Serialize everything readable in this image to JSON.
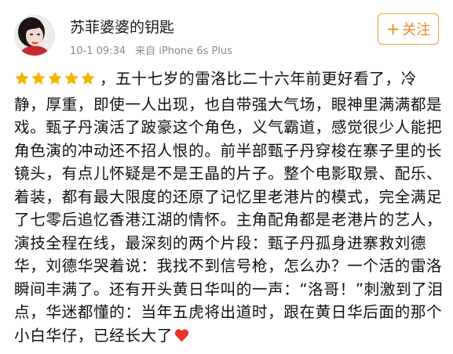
{
  "header": {
    "username": "苏菲婆婆的钥匙",
    "timestamp": "10-1 09:34",
    "source": "来自 iPhone 6s Plus",
    "follow_button": {
      "plus_glyph": "+",
      "label": "关注"
    },
    "avatar": "user-avatar-photo"
  },
  "review": {
    "rating": 5,
    "rating_max": 5,
    "star_color": "#f5b400",
    "text": "，五十七岁的雷洛比二十六年前更好看了，冷静，厚重，即使一人出现，也自带强大气场，眼神里满满都是戏。甄子丹演活了跛豪这个角色，义气霸道，感觉很少人能把角色演的冲动还不招人恨的。前半部甄子丹穿梭在寨子里的长镜头，有点儿怀疑是不是王晶的片子。整个电影取景、配乐、着装，都有最大限度的还原了记忆里老港片的模式，完全满足了七零后追忆香港江湖的情怀。主角配角都是老港片的艺人，演技全程在线，最深刻的两个片段：甄子丹孤身进寨救刘德华，刘德华哭着说：我找不到信号枪，怎么办？一个活的雷洛瞬间丰满了。还有开头黄日华叫的一声：“洛哥！”刺激到了泪点，华迷都懂的：当年五虎将出道时，跟在黄日华后面的那个小白华仔，已经长大了",
    "end_emoji": "red-heart-icon",
    "heart_color": "#e8352b"
  },
  "colors": {
    "accent": "#f08a22",
    "meta_text": "#8a8a8a",
    "body_text": "#111111"
  }
}
